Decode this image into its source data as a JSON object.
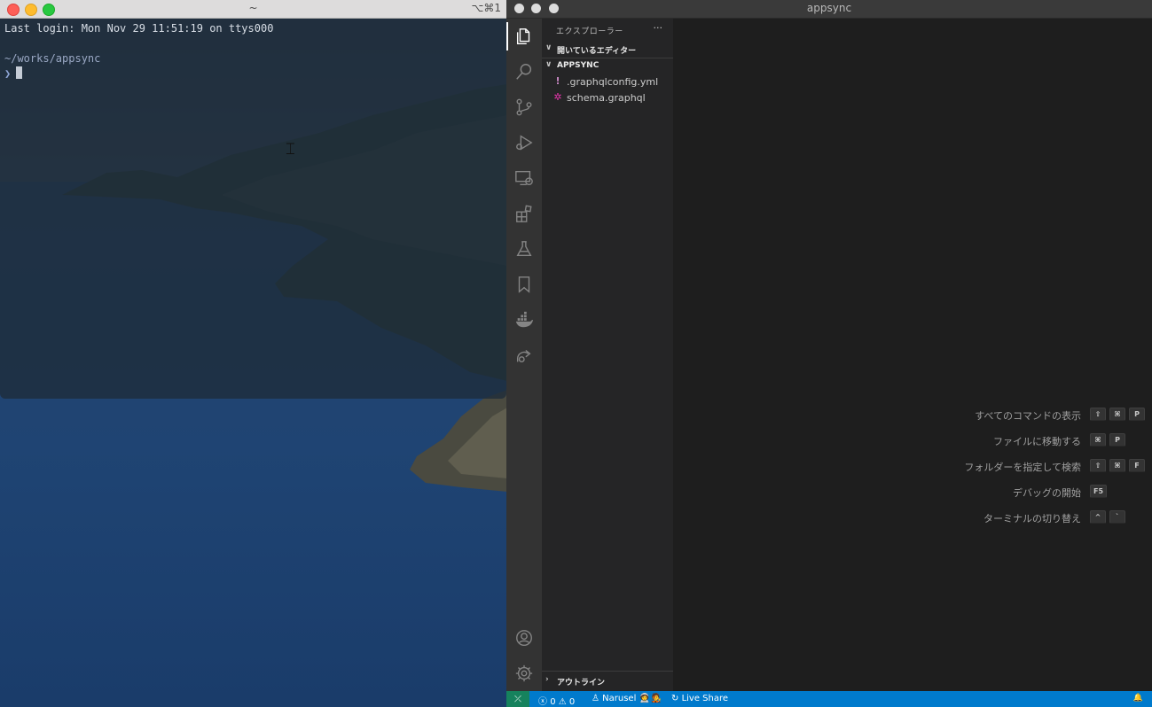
{
  "terminal": {
    "title": "~",
    "shortcut": "⌥⌘1",
    "lines": {
      "login": "Last login: Mon Nov 29 11:51:19 on ttys000",
      "path": "~/works/appsync",
      "prompt": "❯"
    }
  },
  "vscode": {
    "title": "appsync",
    "activity_icons": [
      "files-icon",
      "search-icon",
      "source-control-icon",
      "run-debug-icon",
      "remote-explorer-icon",
      "extensions-icon",
      "testing-icon",
      "bookmarks-icon",
      "docker-icon",
      "live-share-icon",
      "account-icon",
      "manage-gear-icon"
    ],
    "sidebar": {
      "title": "エクスプローラー",
      "more": "···",
      "open_editors": "開いているエディター",
      "folder": "APPSYNC",
      "files": [
        {
          "name": ".graphqlconfig.yml",
          "icon": "!",
          "icon_color": "#c586c0"
        },
        {
          "name": "schema.graphql",
          "icon": "✲",
          "icon_color": "#e535ab"
        }
      ],
      "outline": "アウトライン"
    },
    "welcome": [
      {
        "label": "すべてのコマンドの表示",
        "keys": [
          "⇧",
          "⌘",
          "P"
        ]
      },
      {
        "label": "ファイルに移動する",
        "keys": [
          "⌘",
          "P"
        ]
      },
      {
        "label": "フォルダーを指定して検索",
        "keys": [
          "⇧",
          "⌘",
          "F"
        ]
      },
      {
        "label": "デバッグの開始",
        "keys": [
          "F5"
        ]
      },
      {
        "label": "ターミナルの切り替え",
        "keys": [
          "^",
          "`"
        ]
      }
    ],
    "statusbar": {
      "remote": "⤫",
      "errors": "0",
      "warnings": "0",
      "user": "Narusel 🧑‍🚀🧑‍🎤",
      "live_share": "Live Share",
      "bell": "🔔"
    },
    "colors": {
      "statusbar": "#007acc",
      "activitybar": "#333333",
      "sidebar": "#252526",
      "editor": "#1e1e1e"
    }
  }
}
